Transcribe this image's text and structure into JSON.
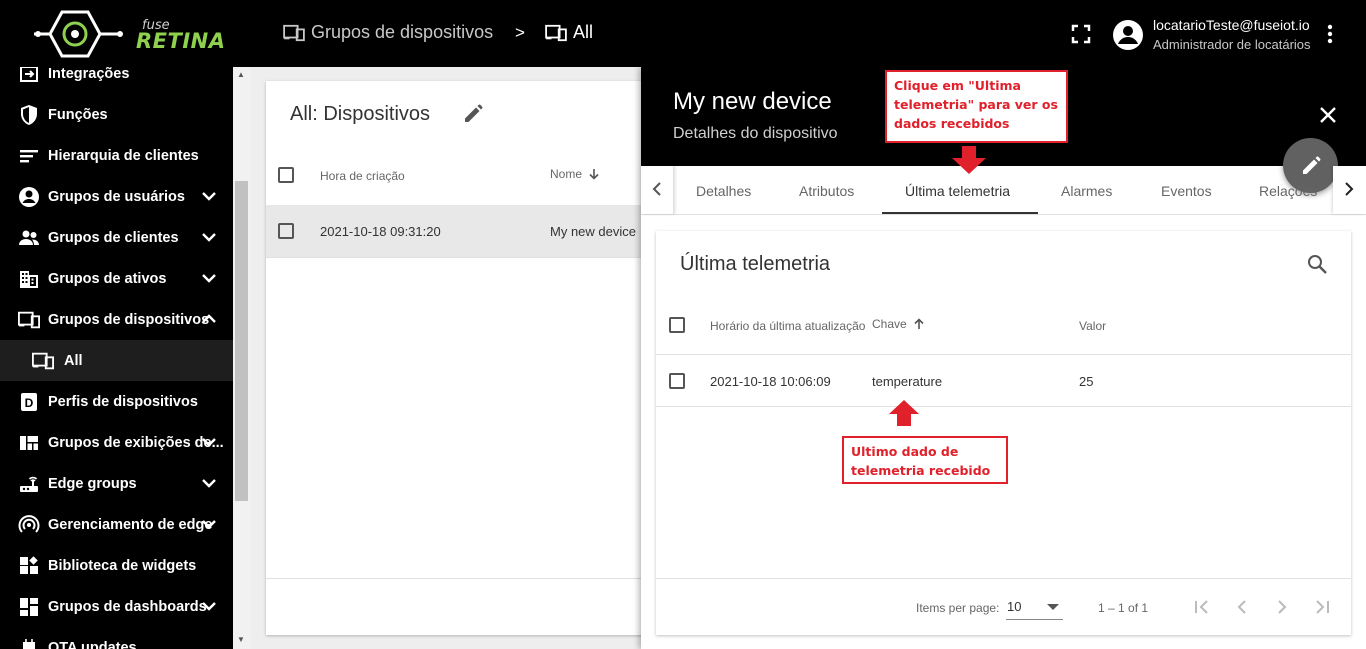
{
  "brand": {
    "fuse": "fuse",
    "name": "RETINA",
    "accent": "#8fd14f"
  },
  "breadcrumb": [
    {
      "label": "Grupos de dispositivos",
      "icon": "devices-icon"
    },
    {
      "separator": ">"
    },
    {
      "label": "All",
      "icon": "devices-icon"
    }
  ],
  "user": {
    "email": "locatarioTeste@fuseiot.io",
    "role": "Administrador de locatários"
  },
  "sidebar": {
    "items": [
      {
        "label": "Integrações",
        "icon": "integrations-icon",
        "expandable": false
      },
      {
        "label": "Funções",
        "icon": "shield-icon",
        "expandable": false
      },
      {
        "label": "Hierarquia de clientes",
        "icon": "hierarchy-icon",
        "expandable": false
      },
      {
        "label": "Grupos de usuários",
        "icon": "account-circle-icon",
        "expandable": true
      },
      {
        "label": "Grupos de clientes",
        "icon": "people-icon",
        "expandable": true
      },
      {
        "label": "Grupos de ativos",
        "icon": "domain-icon",
        "expandable": true
      },
      {
        "label": "Grupos de dispositivos",
        "icon": "devices-icon",
        "expandable": true,
        "expanded": true
      },
      {
        "label": "All",
        "icon": "devices-icon",
        "sub": true
      },
      {
        "label": "Perfis de dispositivos",
        "icon": "device-profile-icon",
        "expandable": false
      },
      {
        "label": "Grupos de exibições de...",
        "icon": "view-quilt-icon",
        "expandable": true
      },
      {
        "label": "Edge groups",
        "icon": "router-icon",
        "expandable": true
      },
      {
        "label": "Gerenciamento de edge",
        "icon": "wifi-tethering-icon",
        "expandable": true
      },
      {
        "label": "Biblioteca de widgets",
        "icon": "widgets-icon",
        "expandable": false
      },
      {
        "label": "Grupos de dashboards",
        "icon": "dashboard-icon",
        "expandable": true
      },
      {
        "label": "OTA updates",
        "icon": "memory-icon",
        "expandable": false
      }
    ]
  },
  "devices": {
    "title": "All: Dispositivos",
    "columns": {
      "created": "Hora de criação",
      "name": "Nome"
    },
    "rows": [
      {
        "created": "2021-10-18 09:31:20",
        "name": "My new device"
      }
    ]
  },
  "detail": {
    "title": "My new device",
    "subtitle": "Detalhes do dispositivo",
    "tabs": [
      "Detalhes",
      "Atributos",
      "Última telemetria",
      "Alarmes",
      "Eventos",
      "Relações"
    ],
    "active_tab": "Última telemetria"
  },
  "telemetry": {
    "title": "Última telemetria",
    "columns": {
      "updated": "Horário da última atualização",
      "key": "Chave",
      "value": "Valor"
    },
    "rows": [
      {
        "updated": "2021-10-18 10:06:09",
        "key": "temperature",
        "value": "25"
      }
    ],
    "footer": {
      "items_per_page_label": "Items per page:",
      "items_per_page": "10",
      "range": "1 – 1 of 1"
    }
  },
  "annotations": {
    "tab_hint": "Clique em \"Ultima telemetria\" para ver os dados recebidos",
    "row_hint": "Ultimo dado de telemetria recebido",
    "color": "#e0202a"
  }
}
